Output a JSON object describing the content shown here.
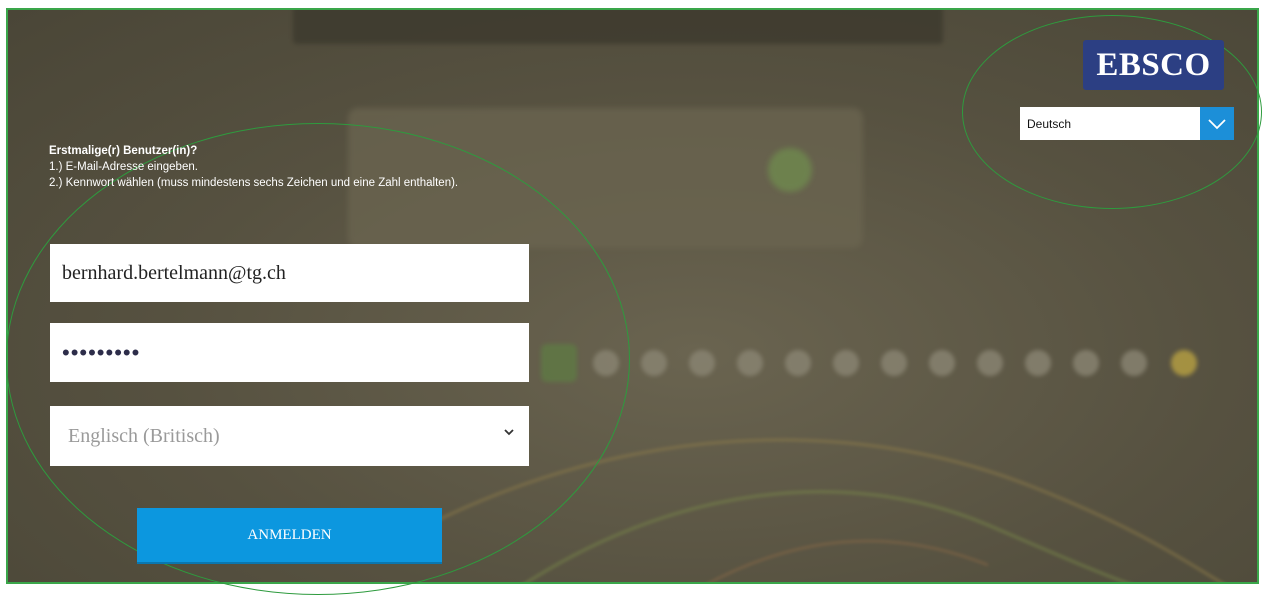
{
  "brand": {
    "logo_text": "EBSCO",
    "logo_color": "#2c3f83"
  },
  "language_selector": {
    "selected": "Deutsch",
    "accent": "#1c8fd8"
  },
  "instructions": {
    "title": "Erstmalige(r) Benutzer(in)?",
    "step1": "1.) E-Mail-Adresse eingeben.",
    "step2": "2.) Kennwort wählen (muss mindestens sechs Zeichen und eine Zahl enthalten)."
  },
  "form": {
    "email_value": "bernhard.bertelmann@tg.ch",
    "password_mask": "•••••••••",
    "interface_language": "Englisch (Britisch)",
    "submit_label": "ANMELDEN",
    "submit_color": "#0c97df"
  },
  "icons": {
    "dropdown": "chevron-down-icon"
  }
}
